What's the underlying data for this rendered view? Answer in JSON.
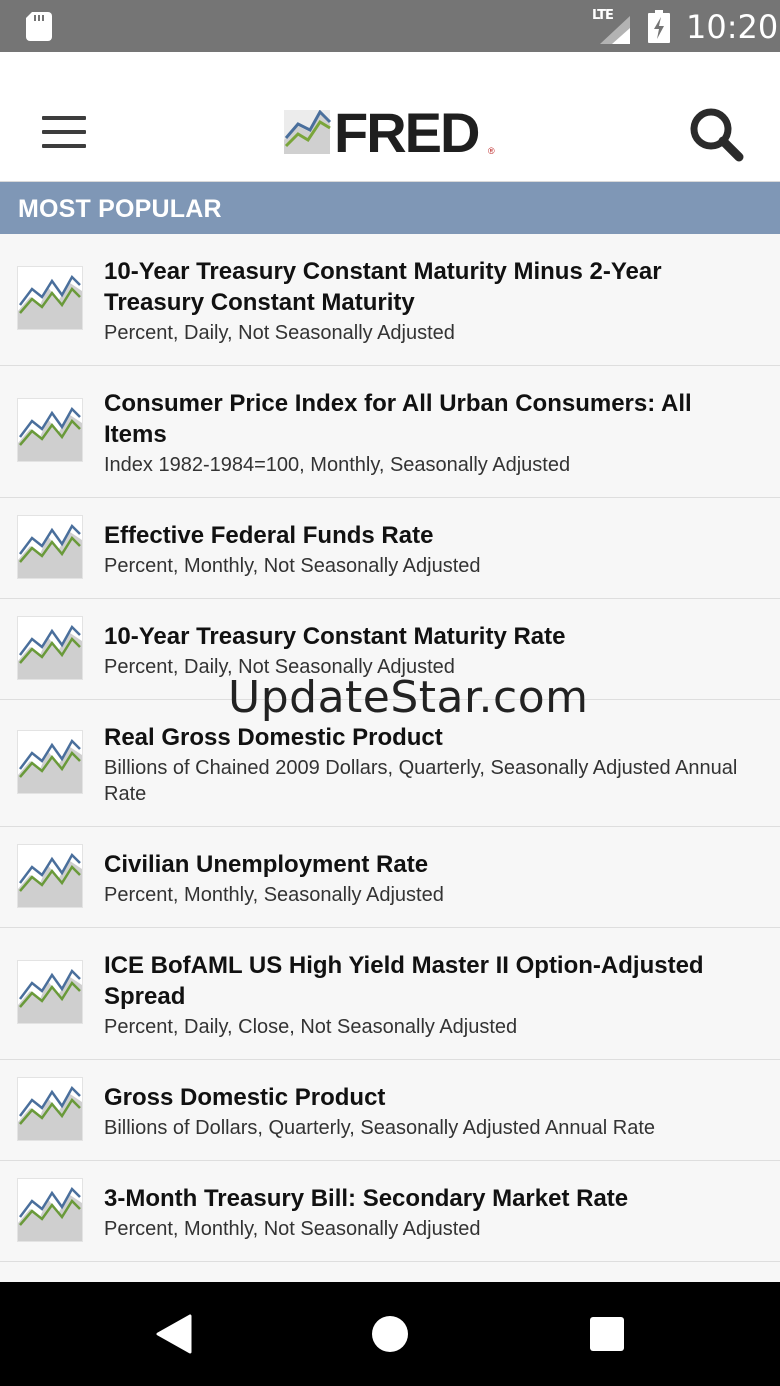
{
  "status_bar": {
    "network": "LTE",
    "time": "10:20"
  },
  "header": {
    "logo_text": "FRED",
    "logo_mark": "®"
  },
  "section": {
    "title": "MOST POPULAR"
  },
  "series": [
    {
      "title": "10-Year Treasury Constant Maturity Minus 2-Year Treasury Constant Maturity",
      "meta": "Percent, Daily, Not Seasonally Adjusted"
    },
    {
      "title": "Consumer Price Index for All Urban Consumers: All Items",
      "meta": "Index 1982-1984=100, Monthly, Seasonally Adjusted"
    },
    {
      "title": "Effective Federal Funds Rate",
      "meta": "Percent, Monthly, Not Seasonally Adjusted"
    },
    {
      "title": "10-Year Treasury Constant Maturity Rate",
      "meta": "Percent, Daily, Not Seasonally Adjusted"
    },
    {
      "title": "Real Gross Domestic Product",
      "meta": "Billions of Chained 2009 Dollars, Quarterly, Seasonally Adjusted Annual Rate"
    },
    {
      "title": "Civilian Unemployment Rate",
      "meta": "Percent, Monthly, Seasonally Adjusted"
    },
    {
      "title": "ICE BofAML US High Yield Master II Option-Adjusted Spread",
      "meta": "Percent, Daily, Close, Not Seasonally Adjusted"
    },
    {
      "title": "Gross Domestic Product",
      "meta": "Billions of Dollars, Quarterly, Seasonally Adjusted Annual Rate"
    },
    {
      "title": "3-Month Treasury Bill: Secondary Market Rate",
      "meta": "Percent, Monthly, Not Seasonally Adjusted"
    }
  ],
  "watermark": "UpdateStar.com",
  "icons": {
    "menu": "hamburger-icon",
    "search": "search-icon",
    "series_thumb": "line-chart-icon",
    "back": "back-triangle-icon",
    "home": "home-circle-icon",
    "recent": "recent-apps-square-icon"
  },
  "colors": {
    "section_bar": "#7f97b6",
    "status_bar": "#757575",
    "chart_blue": "#4a6f9c",
    "chart_green": "#6a9a3a"
  }
}
